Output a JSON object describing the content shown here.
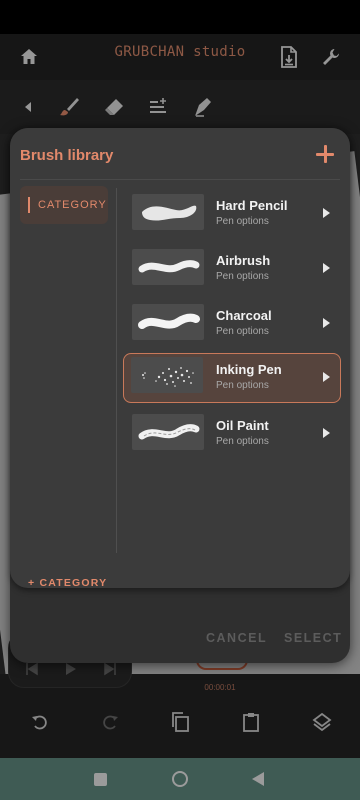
{
  "app": {
    "title": "GRUBCHAN studio"
  },
  "timeline": {
    "time": "00:00:01"
  },
  "brush_library": {
    "title": "Brush library",
    "category_label": "CATEGORY",
    "add_category_label": "+ CATEGORY",
    "brushes": [
      {
        "name": "Hard Pencil",
        "subtitle": "Pen options",
        "selected": false
      },
      {
        "name": "Airbrush",
        "subtitle": "Pen options",
        "selected": false
      },
      {
        "name": "Charcoal",
        "subtitle": "Pen options",
        "selected": false
      },
      {
        "name": "Inking Pen",
        "subtitle": "Pen options",
        "selected": true
      },
      {
        "name": "Oil Paint",
        "subtitle": "Pen options",
        "selected": false
      }
    ]
  },
  "dialog": {
    "cancel_label": "CANCEL",
    "select_label": "SELECT"
  },
  "colors": {
    "accent": "#e2896b",
    "nav_bar": "#618c82"
  }
}
